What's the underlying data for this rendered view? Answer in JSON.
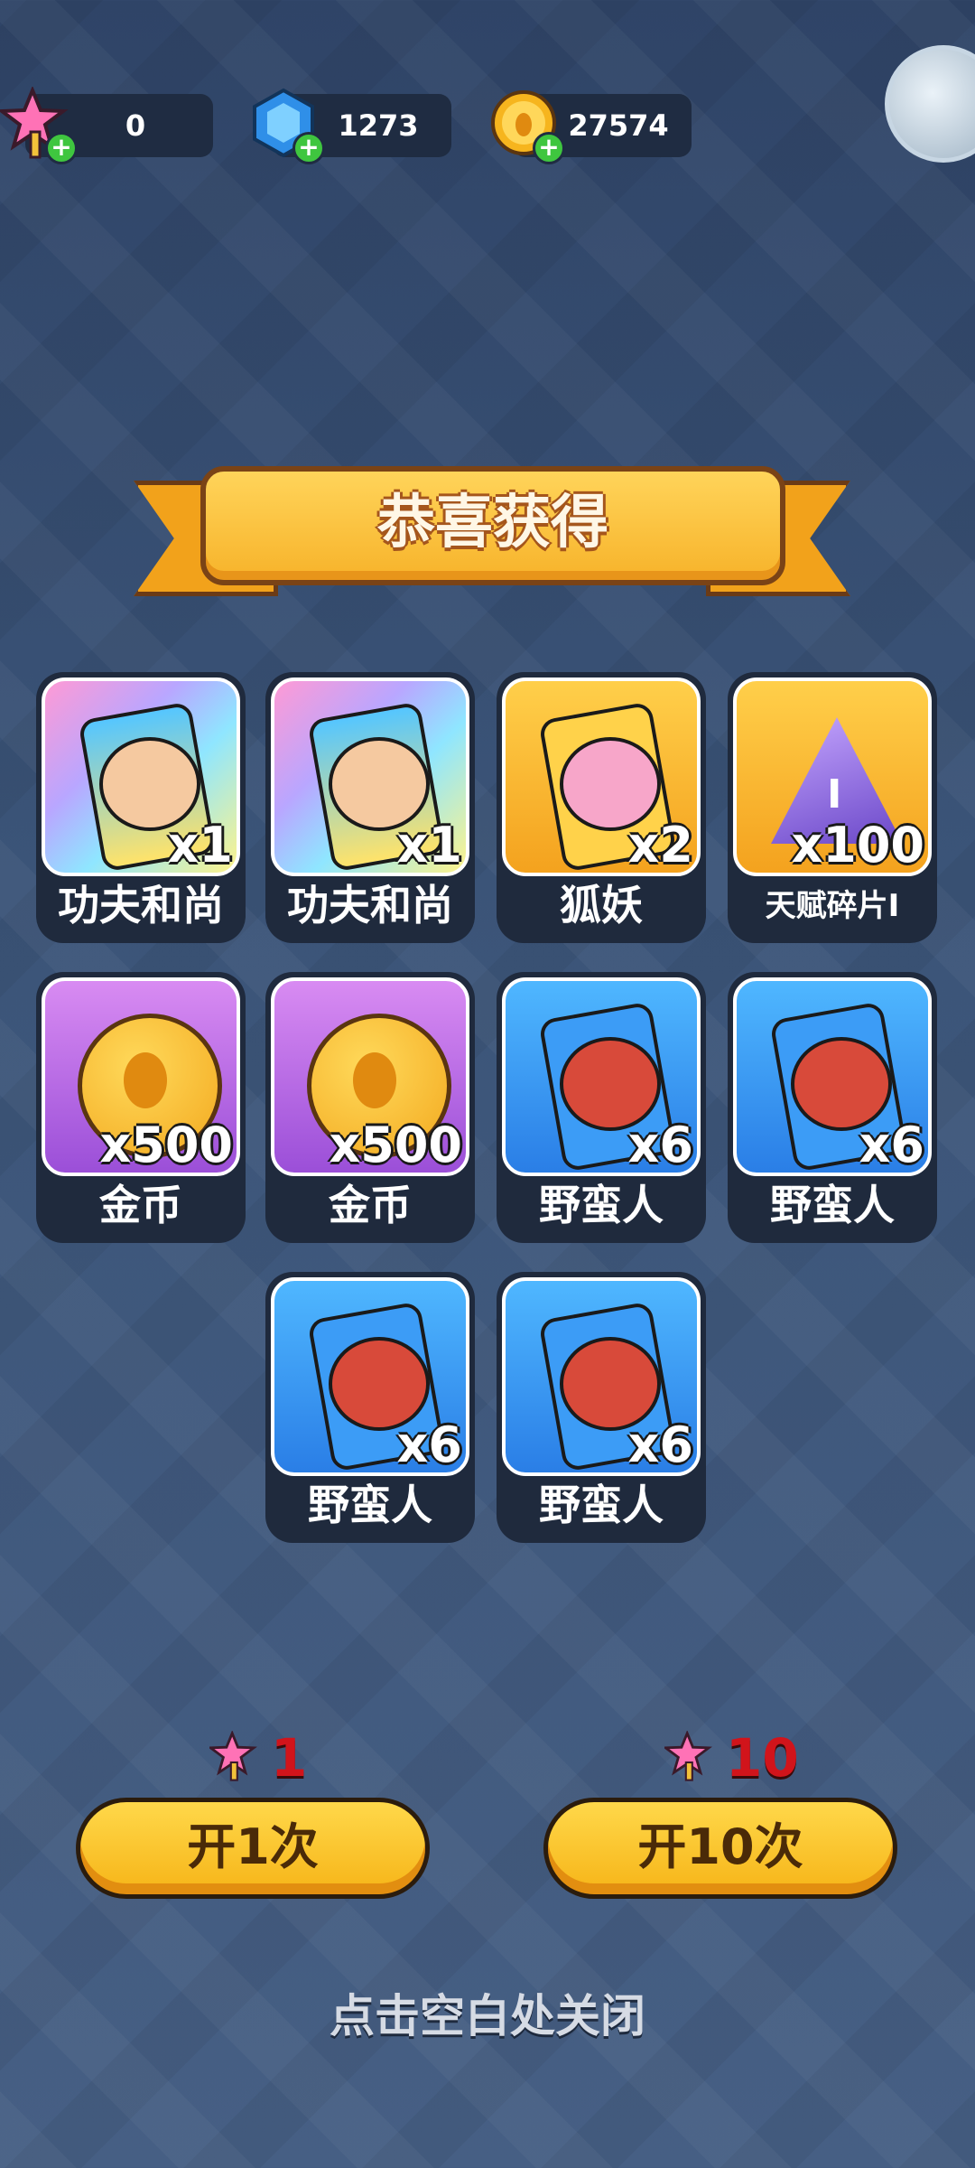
{
  "currencies": [
    {
      "icon": "star-wand-icon",
      "value": "0"
    },
    {
      "icon": "blue-gem-icon",
      "value": "1273"
    },
    {
      "icon": "gold-coin-icon",
      "value": "27574"
    }
  ],
  "banner": {
    "title": "恭喜获得"
  },
  "rewards": [
    {
      "name": "功夫和尚",
      "count": "x1",
      "rarity": "rainbow",
      "art": "monk-card-icon"
    },
    {
      "name": "功夫和尚",
      "count": "x1",
      "rarity": "rainbow",
      "art": "monk-card-icon"
    },
    {
      "name": "狐妖",
      "count": "x2",
      "rarity": "gold",
      "art": "fox-card-icon"
    },
    {
      "name": "天赋碎片Ⅰ",
      "count": "x100",
      "rarity": "gold",
      "art": "talent-shard-icon"
    },
    {
      "name": "金币",
      "count": "x500",
      "rarity": "purple",
      "art": "gold-coin-icon"
    },
    {
      "name": "金币",
      "count": "x500",
      "rarity": "purple",
      "art": "gold-coin-icon"
    },
    {
      "name": "野蛮人",
      "count": "x6",
      "rarity": "blue",
      "art": "barbarian-card-icon"
    },
    {
      "name": "野蛮人",
      "count": "x6",
      "rarity": "blue",
      "art": "barbarian-card-icon"
    },
    {
      "name": "野蛮人",
      "count": "x6",
      "rarity": "blue",
      "art": "barbarian-card-icon"
    },
    {
      "name": "野蛮人",
      "count": "x6",
      "rarity": "blue",
      "art": "barbarian-card-icon"
    }
  ],
  "actions": {
    "open_once": {
      "cost": "1",
      "label": "开1次"
    },
    "open_ten": {
      "cost": "10",
      "label": "开10次"
    }
  },
  "close_hint": "点击空白处关闭"
}
